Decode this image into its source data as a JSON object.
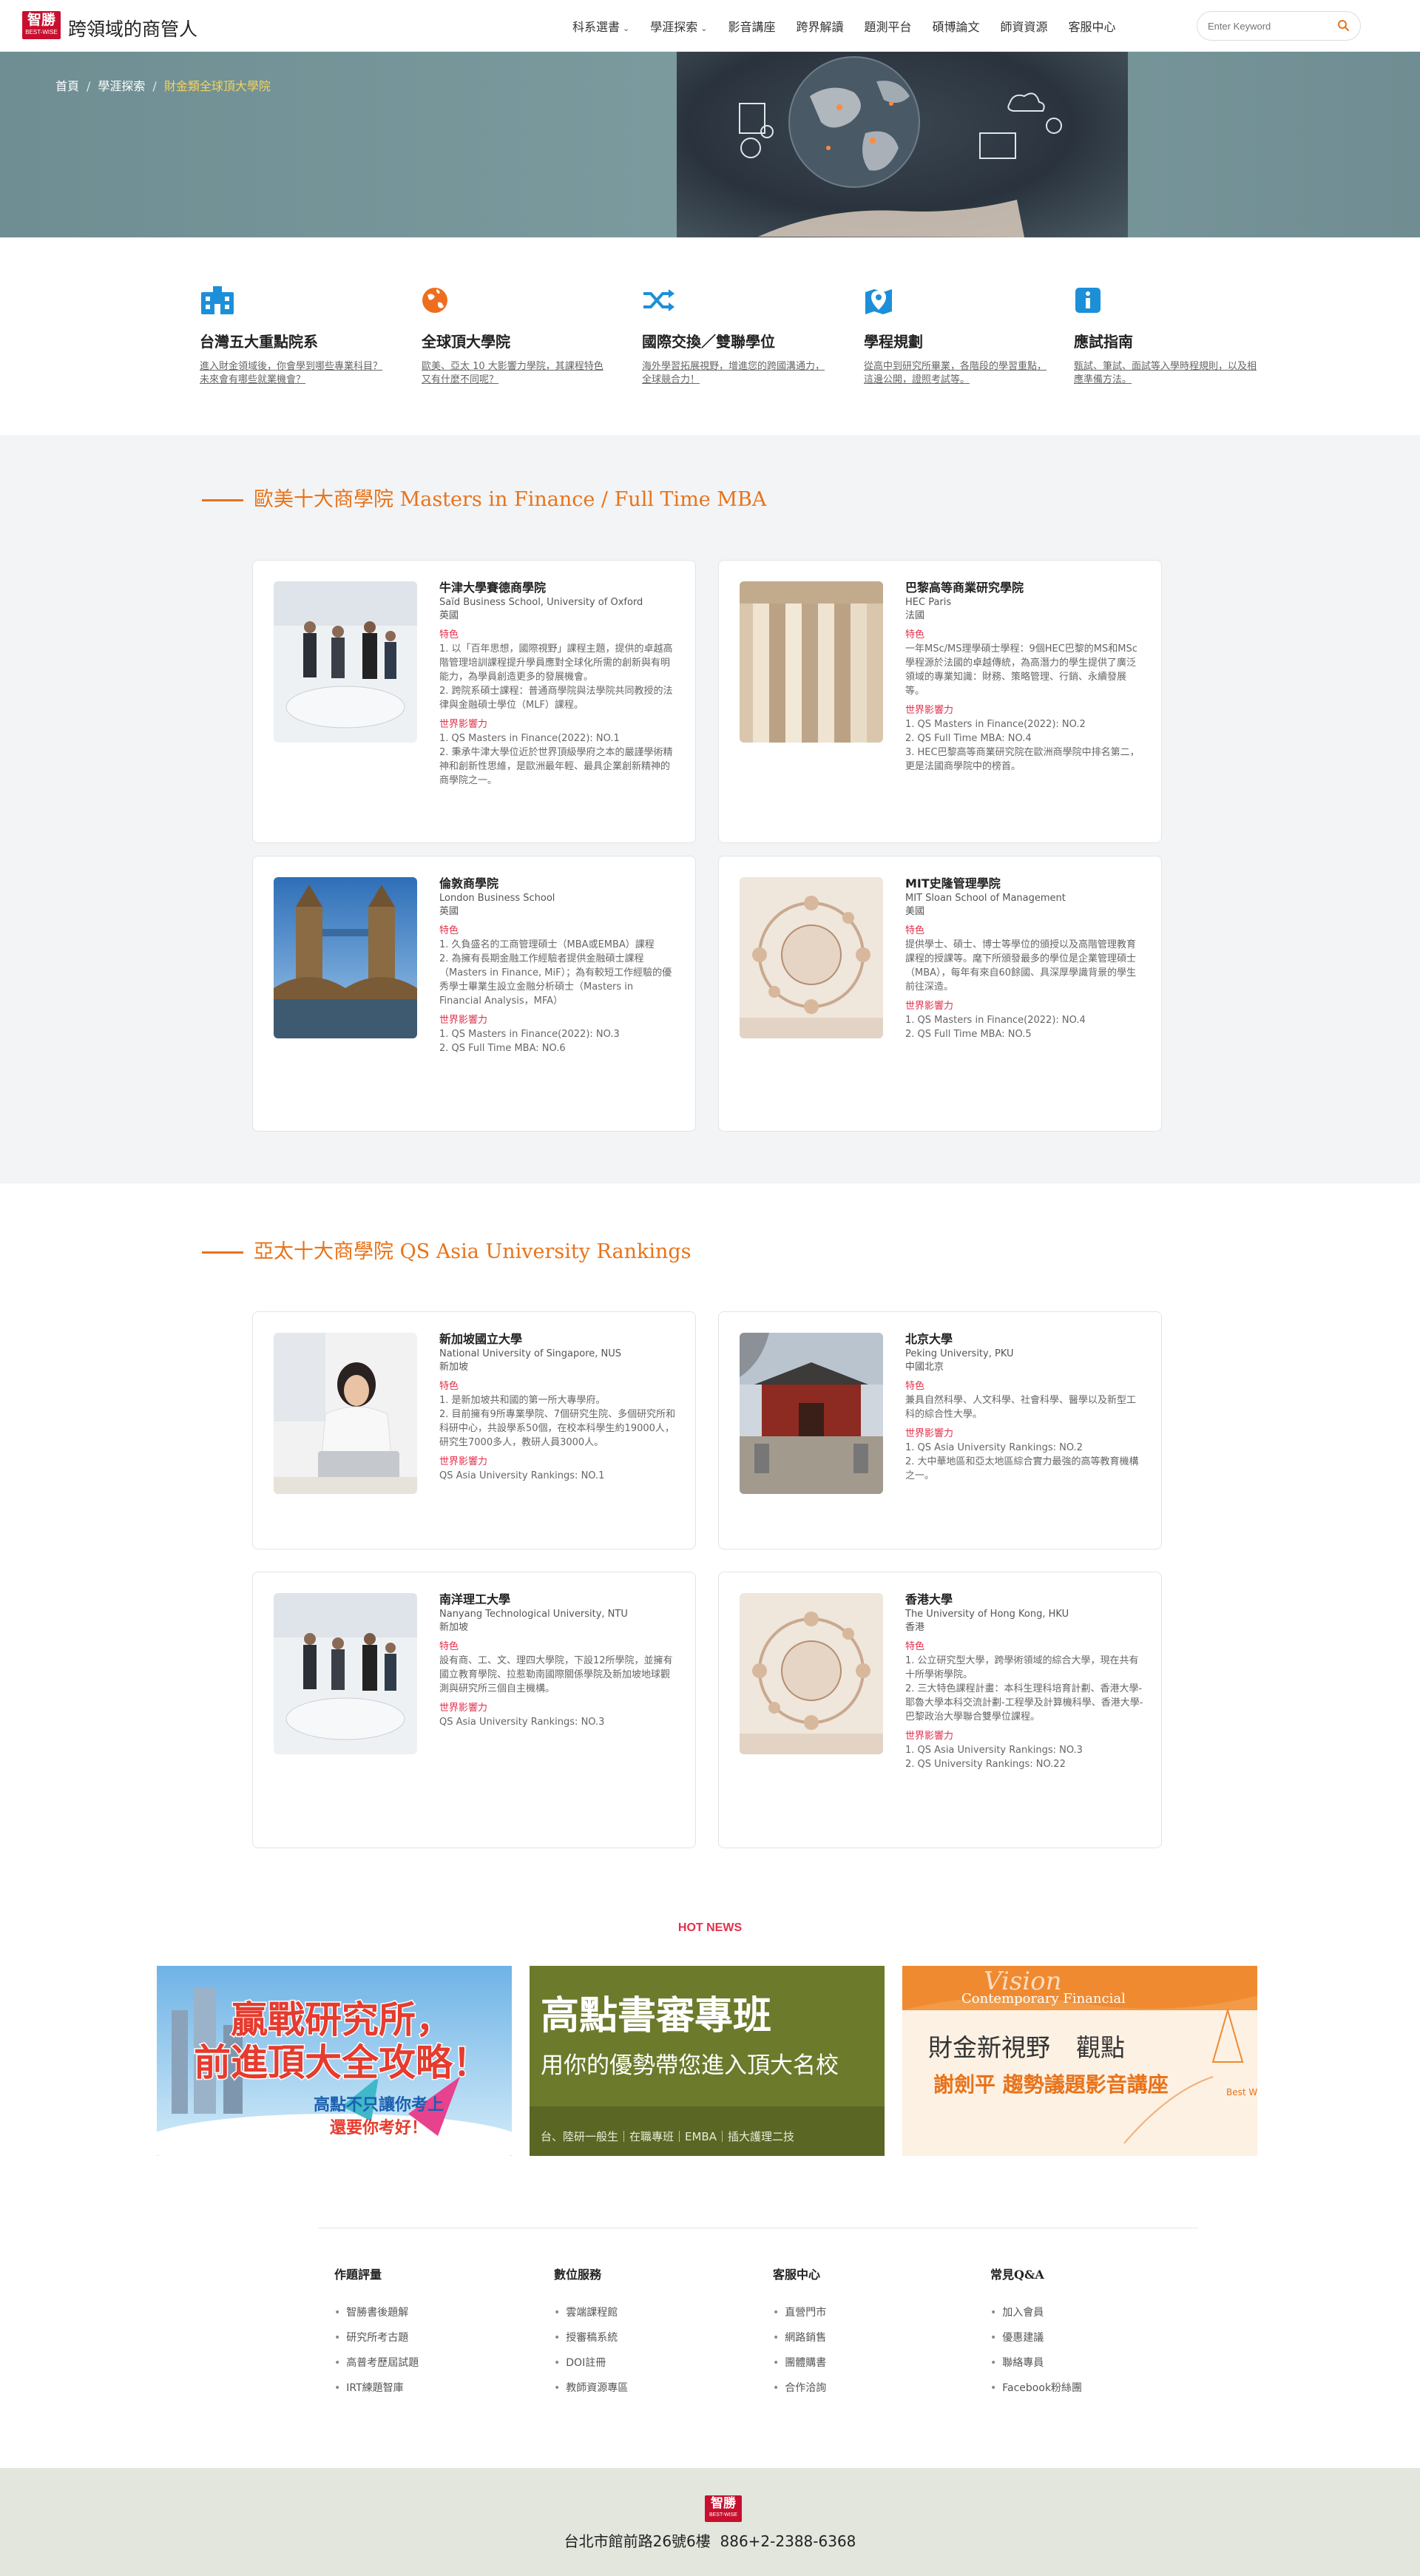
{
  "header": {
    "logo_main": "智勝",
    "logo_sub": "BEST-WISE",
    "site_name": "跨領域的商管人",
    "nav": [
      {
        "label": "科系選書",
        "dropdown": true
      },
      {
        "label": "學涯探索",
        "dropdown": true
      },
      {
        "label": "影音講座",
        "dropdown": false
      },
      {
        "label": "跨界解讀",
        "dropdown": false
      },
      {
        "label": "題測平台",
        "dropdown": false
      },
      {
        "label": "碩博論文",
        "dropdown": false
      },
      {
        "label": "師資資源",
        "dropdown": false
      },
      {
        "label": "客服中心",
        "dropdown": false
      }
    ],
    "search_placeholder": "Enter Keyword"
  },
  "breadcrumb": {
    "home": "首頁",
    "parent": "學涯探索",
    "current": "財金類全球頂大學院"
  },
  "features": [
    {
      "icon": "building-icon",
      "title": "台灣五大重點院系",
      "desc": "進入財金領域後，你會學到哪些專業科目？未來會有哪些就業機會？"
    },
    {
      "icon": "globe-icon",
      "title": "全球頂大學院",
      "desc": "歐美、亞太 10 大影響力學院，其課程特色又有什麼不同呢？"
    },
    {
      "icon": "shuffle-icon",
      "title": "國際交換／雙聯學位",
      "desc": "海外學習拓展視野，增進您的跨國溝通力，全球競合力！"
    },
    {
      "icon": "map-pin-icon",
      "title": "學程規劃",
      "desc": "從高中到研究所畢業，各階段的學習重點，這邊公開，證照考試等。"
    },
    {
      "icon": "info-icon",
      "title": "應試指南",
      "desc": "甄試、筆試、面試等入學時程規則，以及相應準備方法。"
    }
  ],
  "section1": {
    "title": "歐美十大商學院 Masters in Finance / Full Time MBA",
    "cards": [
      {
        "name": "牛津大學賽德商學院",
        "en": "Saïd Business School, University of Oxford",
        "country": "英國",
        "feature_label": "特色",
        "features": [
          "1. 以「百年思想，國際視野」課程主題，提供的卓越高階管理培訓課程提升學員應對全球化所需的創新與有明能力，為學員創造更多的發展機會。",
          "2. 跨院系碩士課程：普通商學院與法學院共同教授的法律與金融碩士學位（MLF）課程。"
        ],
        "impact_label": "世界影響力",
        "impact": [
          "1. QS Masters in Finance(2022): NO.1",
          "2. 秉承牛津大學位近於世界頂級學府之本的嚴謹學術精神和創新性思維，是歐洲最年輕、最具企業創新精神的商學院之一。"
        ]
      },
      {
        "name": "巴黎高等商業研究學院",
        "en": "HEC Paris",
        "country": "法國",
        "feature_label": "特色",
        "features": [
          "一年MSc/MS理學碩士學程：9個HEC巴黎的MS和MSc學程源於法國的卓越傳統，為高潛力的學生提供了廣泛領域的專業知識：財務、策略管理、行銷、永續發展等。"
        ],
        "impact_label": "世界影響力",
        "impact": [
          "1. QS Masters in Finance(2022): NO.2",
          "2. QS Full Time MBA: NO.4",
          "3. HEC巴黎高等商業研究院在歐洲商學院中排名第二，更是法國商學院中的榜首。"
        ]
      },
      {
        "name": "倫敦商學院",
        "en": "London Business School",
        "country": "英國",
        "feature_label": "特色",
        "features": [
          "1. 久負盛名的工商管理碩士（MBA或EMBA）課程",
          "2. 為擁有長期金融工作經驗者提供金融碩士課程（Masters in Finance, MiF）；為有較短工作經驗的優秀學士畢業生設立金融分析碩士（Masters in Financial Analysis，MFA）"
        ],
        "impact_label": "世界影響力",
        "impact": [
          "1. QS Masters in Finance(2022): NO.3",
          "2. QS Full Time MBA: NO.6"
        ]
      },
      {
        "name": "MIT史隆管理學院",
        "en": "MIT Sloan School of Management",
        "country": "美國",
        "feature_label": "特色",
        "features": [
          "提供學士、碩士、博士等學位的頒授以及高階管理教育課程的授課等。麾下所頒發最多的學位是企業管理碩士（MBA），每年有來自60餘國、具深厚學識背景的學生前往深造。"
        ],
        "impact_label": "世界影響力",
        "impact": [
          "1. QS Masters in Finance(2022): NO.4",
          "2. QS Full Time MBA: NO.5"
        ]
      }
    ]
  },
  "section2": {
    "title": "亞太十大商學院 QS Asia University Rankings",
    "cards": [
      {
        "name": "新加坡國立大學",
        "en": "National University of Singapore, NUS",
        "country": "新加坡",
        "feature_label": "特色",
        "features": [
          "1. 是新加坡共和國的第一所大專學府。",
          "2. 目前擁有9所專業學院、7個研究生院、多個研究所和科研中心，共設學系50個，在校本科學生約19000人，研究生7000多人，教研人員3000人。"
        ],
        "impact_label": "世界影響力",
        "impact": [
          "QS Asia University Rankings: NO.1"
        ]
      },
      {
        "name": "北京大學",
        "en": "Peking University, PKU",
        "country": "中國北京",
        "feature_label": "特色",
        "features": [
          "兼具自然科學、人文科學、社會科學、醫學以及新型工科的綜合性大學。"
        ],
        "impact_label": "世界影響力",
        "impact": [
          "1. QS Asia University Rankings: NO.2",
          "2. 大中華地區和亞太地區綜合實力最強的高等教育機構之一。"
        ]
      },
      {
        "name": "南洋理工大學",
        "en": "Nanyang Technological University, NTU",
        "country": "新加坡",
        "feature_label": "特色",
        "features": [
          "設有商、工、文、理四大學院，下設12所學院，並擁有國立教育學院、拉惹勒南國際關係學院及新加坡地球觀測與研究所三個自主機構。"
        ],
        "impact_label": "世界影響力",
        "impact": [
          "QS Asia University Rankings: NO.3"
        ]
      },
      {
        "name": "香港大學",
        "en": "The University of Hong Kong, HKU",
        "country": "香港",
        "feature_label": "特色",
        "features": [
          "1. 公立研究型大學，跨學術領域的綜合大學，現在共有十所學術學院。",
          "2. 三大特色課程計畫：本科生理科培育計劃、香港大學-耶魯大學本科交流計劃-工程學及計算機科學、香港大學-巴黎政治大學聯合雙學位課程。"
        ],
        "impact_label": "世界影響力",
        "impact": [
          "1. QS Asia University Rankings: NO.3",
          "2. QS University Rankings: NO.22"
        ]
      }
    ]
  },
  "hot_news": {
    "label": "HOT NEWS",
    "banners": [
      {
        "line1": "贏戰研究所，",
        "line2": "前進頂大全攻略！",
        "tag1": "高點不只讓你考上",
        "tag2": "還要你考好！"
      },
      {
        "title": "高點書審專班",
        "subtitle": "用你的優勢帶您進入頂大名校",
        "footer": "台、陸研一般生｜在職專班｜EMBA｜插大護理二技"
      },
      {
        "script": "Vision",
        "en": "Contemporary Financial",
        "title1": "財金新視野",
        "title2": "觀點",
        "subtitle": "謝劍平 趨勢議題影音講座",
        "badge": "Best Wise"
      }
    ]
  },
  "footer": {
    "cols": [
      {
        "title": "作題評量",
        "items": [
          "智勝書後題解",
          "研究所考古題",
          "高普考歷屆試題",
          "IRT練題智庫"
        ]
      },
      {
        "title": "數位服務",
        "items": [
          "雲端課程館",
          "授審稿系統",
          "DOI註冊",
          "教師資源專區"
        ]
      },
      {
        "title": "客服中心",
        "items": [
          "直營門市",
          "網路銷售",
          "團體購書",
          "合作洽詢"
        ]
      },
      {
        "title": "常見Q&A",
        "items": [
          "加入會員",
          "優惠建議",
          "聯絡專員",
          "Facebook粉絲團"
        ]
      }
    ],
    "logo_main": "智勝",
    "logo_sub": "BEST-WISE",
    "address": "台北市館前路26號6樓",
    "phone": "886+2-2388-6368"
  },
  "colors": {
    "accent": "#e8731a",
    "brand": "#c8102e",
    "label_red": "#e3304b",
    "icon_blue": "#1c8fd9",
    "icon_orange": "#ee6e1f"
  }
}
